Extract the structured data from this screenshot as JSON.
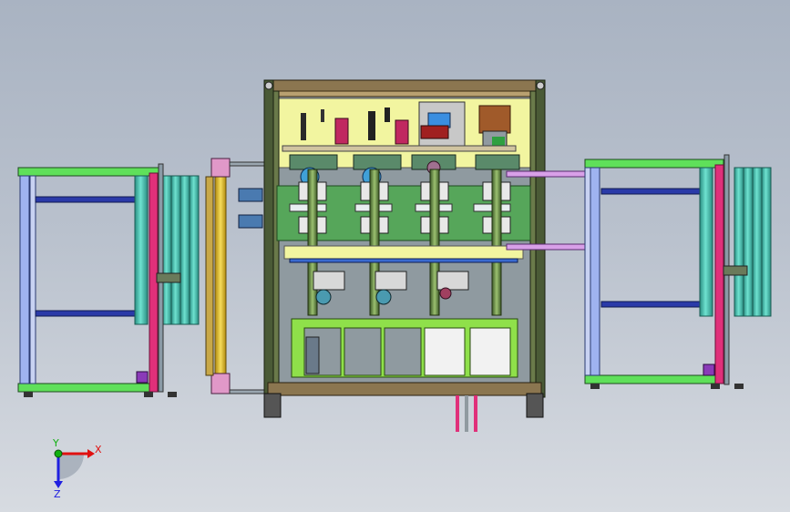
{
  "view": {
    "orientation_triad": {
      "x_label": "X",
      "y_label": "Y",
      "z_label": "Z",
      "x_color": "#e01010",
      "y_color": "#10b010",
      "z_color": "#2020e0"
    }
  },
  "colors": {
    "frame": "#3c3c2a",
    "panel_yellow": "#f2f5a0",
    "green_plate": "#56a65a",
    "lime": "#8fe04a",
    "cyan_roller": "#40c4b0",
    "magenta": "#e0307a",
    "blue_rail": "#3a4cb0",
    "light_blue": "#9fb3f0",
    "violet": "#d8a0e8",
    "conveyor_green": "#5fe05a",
    "gold": "#e8c020"
  }
}
